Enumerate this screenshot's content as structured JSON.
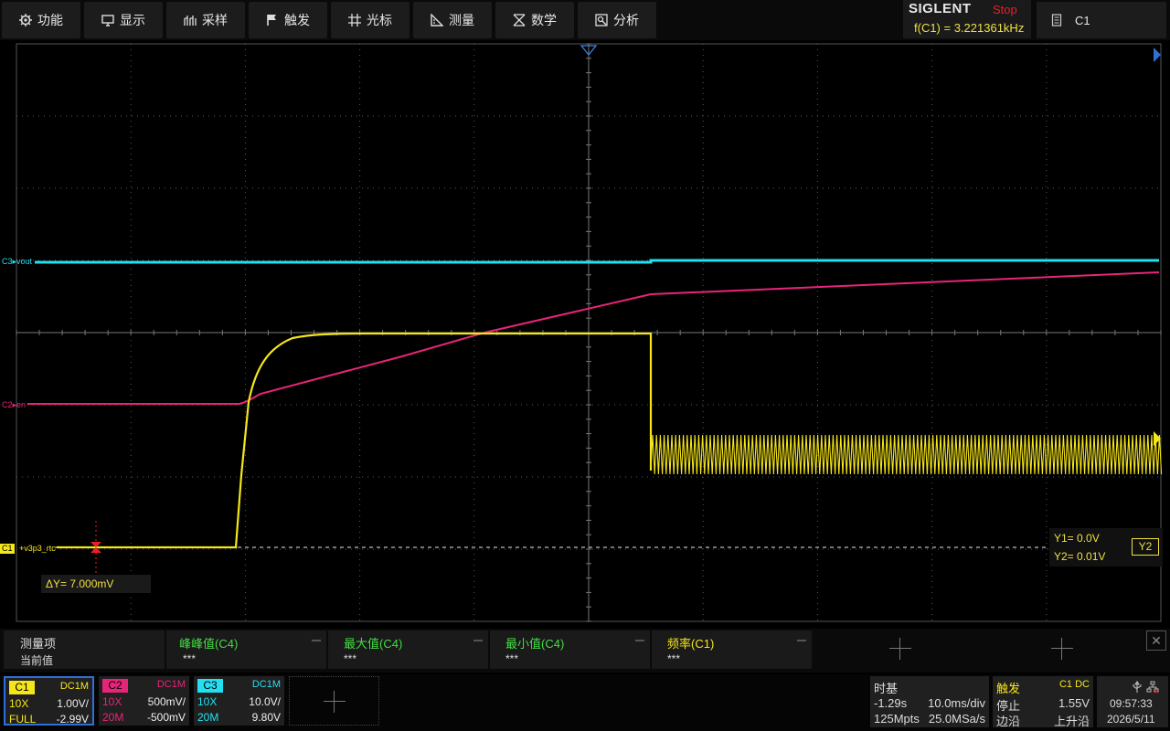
{
  "menu": [
    {
      "label": "功能",
      "icon": "gear-icon"
    },
    {
      "label": "显示",
      "icon": "monitor-icon"
    },
    {
      "label": "采样",
      "icon": "sample-icon"
    },
    {
      "label": "触发",
      "icon": "flag-icon"
    },
    {
      "label": "光标",
      "icon": "crosshair-icon"
    },
    {
      "label": "测量",
      "icon": "ruler-icon"
    },
    {
      "label": "数学",
      "icon": "math-icon"
    },
    {
      "label": "分析",
      "icon": "analysis-icon"
    }
  ],
  "header": {
    "brand": "SIGLENT",
    "run_state": "Stop",
    "freq_readout": "f(C1) = 3.221361kHz",
    "channel_select": "C1"
  },
  "markers": {
    "c3": "C3▸vout",
    "c2": "C2▸en",
    "c1": "C1",
    "c1_name": "+v3p3_rtc"
  },
  "cursor": {
    "delta_y": "ΔY= 7.000mV",
    "y1": "Y1= 0.0V",
    "y2": "Y2= 0.01V",
    "active": "Y2"
  },
  "measure": {
    "row_label": "测量项",
    "value_label": "当前值",
    "items": [
      {
        "name": "峰峰值(C4)",
        "value": "***"
      },
      {
        "name": "最大值(C4)",
        "value": "***"
      },
      {
        "name": "最小值(C4)",
        "value": "***"
      },
      {
        "name": "频率(C1)",
        "value": "***"
      }
    ],
    "close": "✕"
  },
  "channels": [
    {
      "tag": "C1",
      "coupling": "DC1M",
      "probe": "10X",
      "scale": "1.00V/",
      "bw": "FULL",
      "offset": "-2.99V",
      "color": "#f5e61a"
    },
    {
      "tag": "C2",
      "coupling": "DC1M",
      "probe": "10X",
      "scale": "500mV/",
      "bw": "20M",
      "offset": "-500mV",
      "color": "#e8247a"
    },
    {
      "tag": "C3",
      "coupling": "DC1M",
      "probe": "10X",
      "scale": "10.0V/",
      "bw": "20M",
      "offset": "9.80V",
      "color": "#22e0f0"
    }
  ],
  "timebase": {
    "header": "时基",
    "delay": "-1.29s",
    "scale": "10.0ms/div",
    "depth": "125Mpts",
    "rate": "25.0MSa/s"
  },
  "trigger": {
    "header": "触发",
    "source": "C1 DC",
    "mode": "停止",
    "level": "1.55V",
    "type": "边沿",
    "slope": "上升沿"
  },
  "clock": {
    "time": "09:57:33",
    "date": "2026/5/11"
  },
  "colors": {
    "c1": "#f5e61a",
    "c2": "#e8247a",
    "c3": "#22e0f0",
    "accent": "#2f6fd8"
  }
}
